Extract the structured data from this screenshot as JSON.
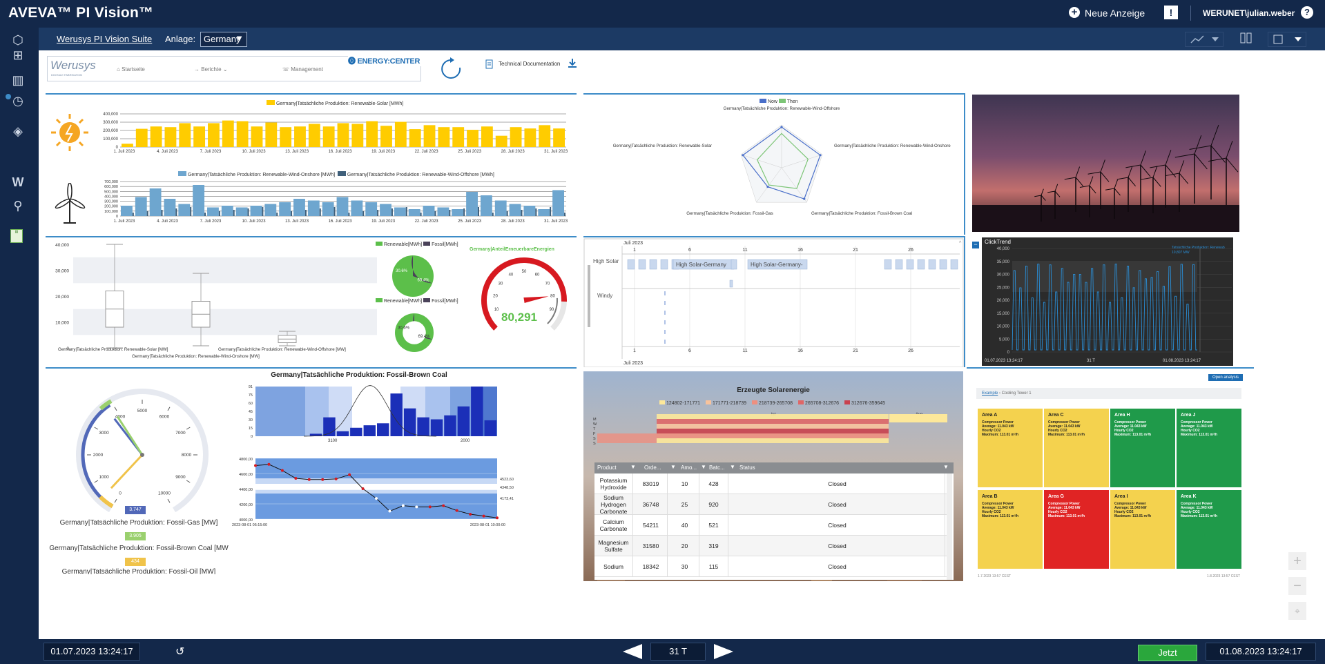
{
  "app": {
    "title": "AVEVA™ PI Vision™",
    "new_display": "Neue Anzeige",
    "user": "WERUNET\\julian.weber",
    "help": "?"
  },
  "subbar": {
    "suite_link": "Werusys PI Vision Suite",
    "anlage_label": "Anlage:",
    "anlage_value": "Germany"
  },
  "nav": {
    "logo": "Werusys",
    "logo_sub": "DIGITALE FABRIKATION",
    "items": [
      "Startseite",
      "Berichte",
      "Management"
    ],
    "energy_logo": "ENERGY:CENTER",
    "tech_doc": "Technical Documentation"
  },
  "colors": {
    "brand_dark": "#13284a",
    "accent": "#3d8cc8",
    "solar": "#ffcc00",
    "wind_onshore": "#6ea6cf",
    "wind_offshore": "#3f5f7a",
    "green": "#5cbf4a",
    "red": "#d71920"
  },
  "chart_solar": {
    "legend": "Germany|Tatsächliche Produktion: Renewable-Solar [MWh]",
    "yticks": [
      "400,000",
      "300,000",
      "200,000",
      "100,000",
      "0"
    ],
    "xticks": [
      "1. Juli 2023",
      "4. Juli 2023",
      "7. Juli 2023",
      "10. Juli 2023",
      "13. Juli 2023",
      "16. Juli 2023",
      "19. Juli 2023",
      "22. Juli 2023",
      "25. Juli 2023",
      "28. Juli 2023",
      "31. Juli 2023"
    ]
  },
  "chart_wind": {
    "legend_onshore": "Germany|Tatsächliche Produktion: Renewable-Wind-Onshore [MWh]",
    "legend_offshore": "Germany|Tatsächliche Produktion: Renewable-Wind-Offshore [MWh]",
    "yticks": [
      "700,000",
      "600,000",
      "500,000",
      "400,000",
      "300,000",
      "200,000",
      "100,000",
      "0"
    ],
    "xticks": [
      "1. Juli 2023",
      "4. Juli 2023",
      "7. Juli 2023",
      "10. Juli 2023",
      "13. Juli 2023",
      "16. Juli 2023",
      "19. Juli 2023",
      "22. Juli 2023",
      "25. Juli 2023",
      "28. Juli 2023",
      "31. Juli 2023"
    ]
  },
  "radar": {
    "legend_now": "Now",
    "legend_then": "Then",
    "labels": [
      "Germany|Tatsächliche Produktion: Renewable-Wind-Offshore",
      "Germany|Tatsächliche Produktion: Renewable-Wind-Onshore",
      "Germany|Tatsächliche Produktion: Fossil-Brown Coal",
      "Germany|Tatsächliche Produktion: Fossil-Gas",
      "Germany|Tatsächliche Produktion: Renewable-Solar"
    ]
  },
  "boxplot": {
    "yticks": [
      "40,000",
      "30,000",
      "20,000",
      "10,000",
      "0"
    ],
    "labels": [
      "Germany|Tatsächliche Produktion: Renewable-Solar [MW]",
      "Germany|Tatsächliche Produktion: Renewable-Wind-Offshore [MW]",
      "Germany|Tatsächliche Produktion: Renewable-Wind-Onshore [MW]"
    ]
  },
  "pies": {
    "pie1_legend": [
      "Renewable[MWh]",
      "Fossil[MWh]"
    ],
    "pie1_values": [
      "30.6%",
      "69.4%"
    ],
    "pie2_legend": [
      "Renewable[MWh]",
      "Fossil[MWh]"
    ],
    "pie2_values": [
      "30.6%",
      "69.4%"
    ]
  },
  "gauge_green": {
    "title": "Germany|AnteilErneuerbareEnergien",
    "value": "80,291",
    "ticks": [
      "10",
      "20",
      "30",
      "40",
      "50",
      "60",
      "70",
      "80",
      "90"
    ]
  },
  "gantt": {
    "month": "Juli 2023",
    "days": [
      "1",
      "6",
      "11",
      "16",
      "21",
      "26"
    ],
    "rows": [
      "High Solar",
      "Windy"
    ],
    "labels": [
      "High Solar-Germany",
      "High Solar-Germany-"
    ]
  },
  "clicktrend": {
    "title": "ClickTrend",
    "legend": "Tatsächliche Produktion: Renewab",
    "legend_value": "10,807 MW",
    "yticks": [
      "40,000",
      "35,000",
      "30,000",
      "25,000",
      "20,000",
      "15,000",
      "10,000",
      "5,000",
      "0"
    ],
    "start": "01.07.2023 13:24:17",
    "span": "31 T",
    "end": "01.08.2023 13:24:17"
  },
  "fossil_gauge": {
    "ticks": [
      "0",
      "1000",
      "2000",
      "3000",
      "4000",
      "5000",
      "6000",
      "7000",
      "8000",
      "9000",
      "10000"
    ],
    "v1": "3.747",
    "l1": "Germany|Tatsächliche Produktion: Fossil-Gas [MW]",
    "v2": "3.905",
    "l2": "Germany|Tatsächliche Produktion: Fossil-Brown Coal [MW",
    "v3": "434",
    "l3": "Germany|Tatsächliche Produktion: Fossil-Oil [MW]"
  },
  "brown_coal": {
    "title": "Germany|Tatsächliche Produktion: Fossil-Brown Coal",
    "hist_yticks": [
      "91",
      "75",
      "60",
      "45",
      "30",
      "15",
      "0"
    ],
    "hist_xticks": [
      "3100",
      "2000"
    ],
    "line_yticks": [
      "4800,00",
      "4600,00",
      "4400,00",
      "4200,00",
      "4000,00"
    ],
    "right_labels": [
      "4523,60",
      "4348,50",
      "4173,41"
    ],
    "x_start": "2023-08-01 05:15:00",
    "x_end": "2023-08-01 10:00:00"
  },
  "solar_heat": {
    "title": "Erzeugte Solarenergie",
    "legend": [
      "124802-171771",
      "171771-218739",
      "218739-265708",
      "265708-312676",
      "312676-359645"
    ],
    "col_ist": "Ist",
    "col_avg": "Avg",
    "months": "M W T F S S",
    "table_headers": [
      "Product",
      "Orde...",
      "Amo...",
      "Batc...",
      "Status"
    ],
    "rows": [
      {
        "product": "Potassium Hydroxide",
        "order": "83019",
        "amount": "10",
        "batch": "428",
        "status": "Closed"
      },
      {
        "product": "Sodium Hydrogen Carbonate",
        "order": "36748",
        "amount": "25",
        "batch": "920",
        "status": "Closed"
      },
      {
        "product": "Calcium Carbonate",
        "order": "54211",
        "amount": "40",
        "batch": "521",
        "status": "Closed"
      },
      {
        "product": "Magnesium Sulfate",
        "order": "31580",
        "amount": "20",
        "batch": "319",
        "status": "Closed"
      },
      {
        "product": "Sodium",
        "order": "18342",
        "amount": "30",
        "batch": "115",
        "status": "Closed"
      }
    ]
  },
  "cooling": {
    "open_btn": "Open analysis",
    "crumb1": "Example",
    "crumb2": "Cooling Tower 1",
    "tiles": [
      {
        "name": "Area A",
        "color": "#f4d24e"
      },
      {
        "name": "Area C",
        "color": "#f4d24e"
      },
      {
        "name": "Area H",
        "color": "#1f9a4a"
      },
      {
        "name": "Area J",
        "color": "#1f9a4a"
      },
      {
        "name": "Area B",
        "color": "#f4d24e"
      },
      {
        "name": "Area G",
        "color": "#e02424"
      },
      {
        "name": "Area I",
        "color": "#f4d24e"
      },
      {
        "name": "Area K",
        "color": "#1f9a4a"
      }
    ],
    "tile_lines": [
      "Compressor Power",
      "Average: 11.043 kW",
      "Hourly CO2",
      "Maximum: 113.01 m³/h"
    ],
    "foot_left": "1.7.2023 13:57 CEST",
    "foot_right": "1.8.2023 13:57 CEST"
  },
  "bottom": {
    "start": "01.07.2023 13:24:17",
    "span": "31 T",
    "now": "Jetzt",
    "end": "01.08.2023 13:24:17"
  }
}
